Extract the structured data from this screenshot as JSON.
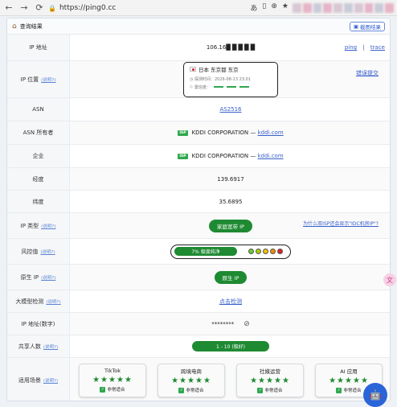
{
  "browser": {
    "back": "←",
    "forward": "→",
    "reload": "⟳",
    "url": "https://ping0.cc"
  },
  "header": {
    "title": "查询结果",
    "screenshot_btn": "截图结果"
  },
  "rows": {
    "ip": {
      "label": "IP 地址",
      "value": "106.16█ █ █ █ █",
      "ping": "ping",
      "sep": "|",
      "trace": "trace"
    },
    "location": {
      "label": "IP 位置",
      "help": "(说明?)",
      "place": "日本 东京都 东京",
      "probe_label": "探测时间：",
      "probe_time": "2026-08-13 23:01",
      "credit_label": "置信度：",
      "report": "错误提交"
    },
    "asn": {
      "label": "ASN",
      "value": "AS2516"
    },
    "asn_owner": {
      "label": "ASN 所有者",
      "badge": "ISP",
      "value": "KDDI CORPORATION —",
      "domain": "kddi.com"
    },
    "company": {
      "label": "企业",
      "badge": "ISP",
      "value": "KDDI CORPORATION —",
      "domain": "kddi.com"
    },
    "longitude": {
      "label": "经度",
      "value": "139.6917"
    },
    "latitude": {
      "label": "纬度",
      "value": "35.6895"
    },
    "ip_type": {
      "label": "IP 类型",
      "help": "(说明?)",
      "value": "家庭宽带 IP",
      "note": "为什么双ISP还会显示\"IDC机房IP\"?"
    },
    "risk": {
      "label": "风控值",
      "help": "(说明?)",
      "value": "7%  极度纯净",
      "dot_colors": [
        "#66cc33",
        "#a8d000",
        "#f2c200",
        "#f08a00",
        "#dd2222"
      ]
    },
    "native": {
      "label": "原生 IP",
      "help": "(说明?)",
      "value": "原生 IP"
    },
    "llm": {
      "label": "大模型检测",
      "help": "(说明?)",
      "value": "点击检测"
    },
    "ip_num": {
      "label": "IP 地址(数字)",
      "value": "********"
    },
    "share": {
      "label": "共享人数",
      "help": "(说明?)",
      "value": "1 - 10 (极好)"
    },
    "scenes": {
      "label": "适用场景",
      "help": "(说明?)",
      "items": [
        {
          "name": "TikTok",
          "stars": "★★★★★",
          "ok": "非常适合"
        },
        {
          "name": "跨境电商",
          "stars": "★★★★★",
          "ok": "非常适合"
        },
        {
          "name": "社媒运营",
          "stars": "★★★★★",
          "ok": "非常适合"
        },
        {
          "name": "AI 应用",
          "stars": "★★★★★",
          "ok": "非常适合"
        }
      ]
    }
  },
  "colors": {
    "green": "#1e8a32",
    "link": "#3960cc"
  },
  "float": {
    "pink_icon": "文",
    "chat_icon": "🤖"
  }
}
